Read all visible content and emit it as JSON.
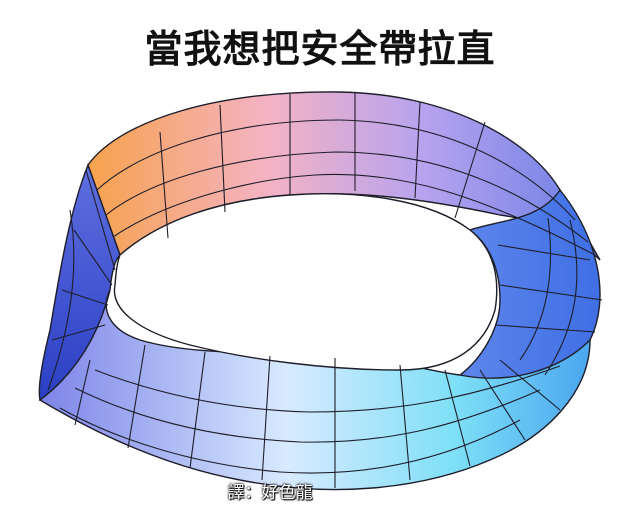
{
  "caption": "當我想把安全帶拉直",
  "credit": "譯：好色龍",
  "figure": {
    "subject": "mobius-strip",
    "colors": [
      "#f7a24c",
      "#f4b3c4",
      "#9e8fe8",
      "#3f56d6",
      "#6fd5f0",
      "#dff3ff"
    ],
    "grid_color": "#1e1e2a"
  }
}
